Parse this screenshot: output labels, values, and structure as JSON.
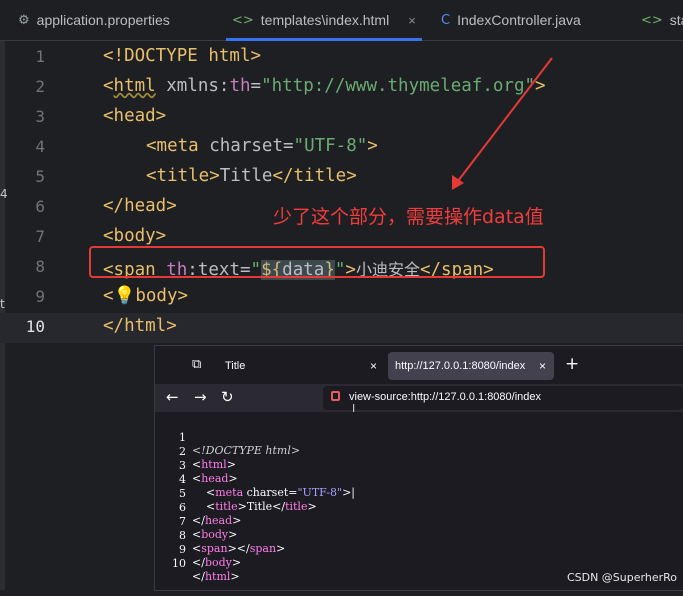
{
  "ide": {
    "tabs": [
      {
        "label": "application.properties",
        "icon": "gear-icon"
      },
      {
        "label": "templates\\index.html",
        "icon": "html-tag-icon",
        "active": true
      },
      {
        "label": "IndexController.java",
        "icon": "class-icon"
      },
      {
        "label": "sta",
        "icon": "html-tag-icon"
      }
    ],
    "close_glyph": "×",
    "tab_icon_glyphs": {
      "gear": "⚙",
      "tag": "<>",
      "class": "C"
    },
    "line_numbers": [
      "1",
      "2",
      "3",
      "4",
      "5",
      "6",
      "7",
      "8",
      "9",
      "10"
    ],
    "code": {
      "l1": {
        "t1": "<!DOCTYPE html>"
      },
      "l2": {
        "t1": "<",
        "t2": "html",
        "t3": " xmlns:",
        "t4": "th",
        "t5": "=",
        "t6": "\"http://www.thymeleaf.org\"",
        "t7": ">"
      },
      "l3": {
        "t1": "<head>"
      },
      "l4": {
        "t1": "<meta",
        "t2": " charset",
        "t3": "=",
        "t4": "\"UTF-8\"",
        "t5": ">"
      },
      "l5": {
        "t1": "<title>",
        "t2": "Title",
        "t3": "</title>"
      },
      "l6": {
        "t1": "</head>"
      },
      "l7": {
        "t1": "<body>"
      },
      "l8": {
        "t1": "<span",
        "t2": " th",
        "t3": ":text",
        "t4": "=",
        "t5": "\"",
        "t6": "${",
        "t7": "data",
        "t8": "}",
        "t9": "\"",
        "t10": ">",
        "t11": "小迪安全",
        "t12": "</span>"
      },
      "l9": {
        "t1": "<",
        "t2": "💡",
        "t3": "body>"
      },
      "l10": {
        "t1": "</html>"
      }
    },
    "left_markers": [
      "4",
      "t"
    ]
  },
  "annotation": {
    "text": "少了这个部分，需要操作data值",
    "color": "#f03c3c"
  },
  "browser": {
    "tab_view_glyph": "⧉",
    "tabs": [
      {
        "label": "Title"
      },
      {
        "label": "http://127.0.0.1:8080/index",
        "active": true
      }
    ],
    "close_glyph": "×",
    "new_tab_glyph": "+",
    "nav": {
      "back": "←",
      "forward": "→",
      "reload": "↻"
    },
    "url": "view-source:http://127.0.0.1:8080/index",
    "cursor_glyph": "I",
    "source_lines": [
      {
        "num": "1",
        "parts": [
          "<!DOCTYPE html>"
        ]
      },
      {
        "num": "2",
        "parts": [
          "<",
          "html",
          ">"
        ]
      },
      {
        "num": "3",
        "parts": [
          "<",
          "head",
          ">"
        ]
      },
      {
        "num": "4",
        "parts": [
          "    <",
          "meta",
          " charset",
          "=",
          "\"UTF-8\"",
          ">|"
        ]
      },
      {
        "num": "5",
        "parts": [
          "    <",
          "title",
          ">",
          "Title",
          "</",
          "title",
          ">"
        ]
      },
      {
        "num": "6",
        "parts": [
          "</",
          "head",
          ">"
        ]
      },
      {
        "num": "7",
        "parts": [
          "<",
          "body",
          ">"
        ]
      },
      {
        "num": "8",
        "parts": [
          "<",
          "span",
          "></",
          "span",
          ">"
        ]
      },
      {
        "num": "9",
        "parts": [
          "</",
          "body",
          ">"
        ]
      },
      {
        "num": "10",
        "parts": [
          "</",
          "html",
          ">"
        ]
      }
    ]
  },
  "watermark": "CSDN @SuperherRo",
  "colors": {
    "accent": "#3574f0",
    "tag": "#e8bf6a",
    "string": "#6aab73",
    "annotation": "#e53935"
  }
}
